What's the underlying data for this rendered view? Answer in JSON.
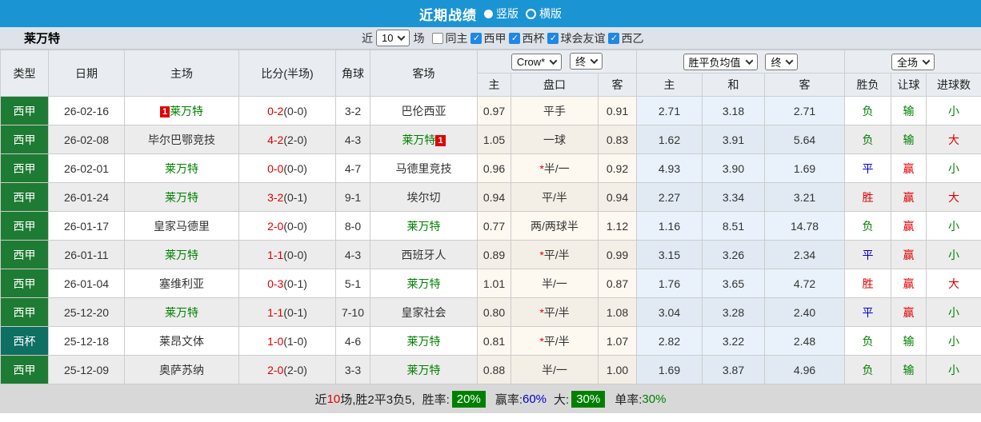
{
  "colors": {
    "title_bar_blue": "#1b94d3",
    "league_green": "#1e7b33",
    "cup_teal": "#0e6f63",
    "levante_green": "#008000",
    "loss_red": "#e00000",
    "draw_blue": "#0000cc",
    "checkbox_blue": "#1e88e5",
    "badge_green": "#008000"
  },
  "title_bar": {
    "title": "近期战绩",
    "options": [
      {
        "label": "竖版",
        "checked": true
      },
      {
        "label": "横版",
        "checked": false
      }
    ]
  },
  "filter_bar": {
    "team": "莱万特",
    "near_label": "近",
    "count_value": "10",
    "games_label": "场",
    "same_home_label": "同主",
    "same_home_checked": false,
    "leagues": [
      "西甲",
      "西杯",
      "球会友谊",
      "西乙"
    ]
  },
  "header": {
    "col_type": "类型",
    "col_date": "日期",
    "col_home": "主场",
    "col_score": "比分(半场)",
    "col_corner": "角球",
    "col_away": "客场",
    "dd_company": "Crow*",
    "dd_final1": "终",
    "dd_avg": "胜平负均值",
    "dd_final2": "终",
    "dd_scope": "全场",
    "sub": [
      "主",
      "盘口",
      "客",
      "主",
      "和",
      "客",
      "胜负",
      "让球",
      "进球数"
    ]
  },
  "rows": [
    {
      "type": "西甲",
      "type_color": "green",
      "date": "26-02-16",
      "home": {
        "name": "莱万特",
        "levante": true,
        "card": "1",
        "card_pos": "before"
      },
      "score": "0-2",
      "half": "(0-0)",
      "corner": "3-2",
      "away": {
        "name": "巴伦西亚",
        "levante": false,
        "card": null
      },
      "odds_home": "0.97",
      "handicap": "平手",
      "handicap_star": false,
      "odds_away": "0.91",
      "avg_home": "2.71",
      "avg_draw": "3.18",
      "avg_away": "2.71",
      "result": {
        "text": "负",
        "color": "green"
      },
      "cover": {
        "text": "输",
        "color": "green"
      },
      "goals": {
        "text": "小",
        "color": "green"
      }
    },
    {
      "type": "西甲",
      "type_color": "green",
      "date": "26-02-08",
      "home": {
        "name": "毕尔巴鄂竞技",
        "levante": false,
        "card": null
      },
      "score": "4-2",
      "half": "(2-0)",
      "corner": "4-3",
      "away": {
        "name": "莱万特",
        "levante": true,
        "card": "1",
        "card_pos": "after"
      },
      "odds_home": "1.05",
      "handicap": "一球",
      "handicap_star": false,
      "odds_away": "0.83",
      "avg_home": "1.62",
      "avg_draw": "3.91",
      "avg_away": "5.64",
      "result": {
        "text": "负",
        "color": "green"
      },
      "cover": {
        "text": "输",
        "color": "green"
      },
      "goals": {
        "text": "大",
        "color": "red"
      }
    },
    {
      "type": "西甲",
      "type_color": "green",
      "date": "26-02-01",
      "home": {
        "name": "莱万特",
        "levante": true,
        "card": null
      },
      "score": "0-0",
      "half": "(0-0)",
      "corner": "4-7",
      "away": {
        "name": "马德里竞技",
        "levante": false,
        "card": null
      },
      "odds_home": "0.96",
      "handicap": "半/一",
      "handicap_star": true,
      "odds_away": "0.92",
      "avg_home": "4.93",
      "avg_draw": "3.90",
      "avg_away": "1.69",
      "result": {
        "text": "平",
        "color": "blue"
      },
      "cover": {
        "text": "赢",
        "color": "red"
      },
      "goals": {
        "text": "小",
        "color": "green"
      }
    },
    {
      "type": "西甲",
      "type_color": "green",
      "date": "26-01-24",
      "home": {
        "name": "莱万特",
        "levante": true,
        "card": null
      },
      "score": "3-2",
      "half": "(0-1)",
      "corner": "9-1",
      "away": {
        "name": "埃尔切",
        "levante": false,
        "card": null
      },
      "odds_home": "0.94",
      "handicap": "平/半",
      "handicap_star": false,
      "odds_away": "0.94",
      "avg_home": "2.27",
      "avg_draw": "3.34",
      "avg_away": "3.21",
      "result": {
        "text": "胜",
        "color": "red"
      },
      "cover": {
        "text": "赢",
        "color": "red"
      },
      "goals": {
        "text": "大",
        "color": "red"
      }
    },
    {
      "type": "西甲",
      "type_color": "green",
      "date": "26-01-17",
      "home": {
        "name": "皇家马德里",
        "levante": false,
        "card": null
      },
      "score": "2-0",
      "half": "(0-0)",
      "corner": "8-0",
      "away": {
        "name": "莱万特",
        "levante": true,
        "card": null
      },
      "odds_home": "0.77",
      "handicap": "两/两球半",
      "handicap_star": false,
      "odds_away": "1.12",
      "avg_home": "1.16",
      "avg_draw": "8.51",
      "avg_away": "14.78",
      "result": {
        "text": "负",
        "color": "green"
      },
      "cover": {
        "text": "赢",
        "color": "red"
      },
      "goals": {
        "text": "小",
        "color": "green"
      }
    },
    {
      "type": "西甲",
      "type_color": "green",
      "date": "26-01-11",
      "home": {
        "name": "莱万特",
        "levante": true,
        "card": null
      },
      "score": "1-1",
      "half": "(0-0)",
      "corner": "4-3",
      "away": {
        "name": "西班牙人",
        "levante": false,
        "card": null
      },
      "odds_home": "0.89",
      "handicap": "平/半",
      "handicap_star": true,
      "odds_away": "0.99",
      "avg_home": "3.15",
      "avg_draw": "3.26",
      "avg_away": "2.34",
      "result": {
        "text": "平",
        "color": "blue"
      },
      "cover": {
        "text": "赢",
        "color": "red"
      },
      "goals": {
        "text": "小",
        "color": "green"
      }
    },
    {
      "type": "西甲",
      "type_color": "green",
      "date": "26-01-04",
      "home": {
        "name": "塞维利亚",
        "levante": false,
        "card": null
      },
      "score": "0-3",
      "half": "(0-1)",
      "corner": "5-1",
      "away": {
        "name": "莱万特",
        "levante": true,
        "card": null
      },
      "odds_home": "1.01",
      "handicap": "半/一",
      "handicap_star": false,
      "odds_away": "0.87",
      "avg_home": "1.76",
      "avg_draw": "3.65",
      "avg_away": "4.72",
      "result": {
        "text": "胜",
        "color": "red"
      },
      "cover": {
        "text": "赢",
        "color": "red"
      },
      "goals": {
        "text": "大",
        "color": "red"
      }
    },
    {
      "type": "西甲",
      "type_color": "green",
      "date": "25-12-20",
      "home": {
        "name": "莱万特",
        "levante": true,
        "card": null
      },
      "score": "1-1",
      "half": "(0-1)",
      "corner": "7-10",
      "away": {
        "name": "皇家社会",
        "levante": false,
        "card": null
      },
      "odds_home": "0.80",
      "handicap": "平/半",
      "handicap_star": true,
      "odds_away": "1.08",
      "avg_home": "3.04",
      "avg_draw": "3.28",
      "avg_away": "2.40",
      "result": {
        "text": "平",
        "color": "blue"
      },
      "cover": {
        "text": "赢",
        "color": "red"
      },
      "goals": {
        "text": "小",
        "color": "green"
      }
    },
    {
      "type": "西杯",
      "type_color": "teal",
      "date": "25-12-18",
      "home": {
        "name": "莱昂文体",
        "levante": false,
        "card": null
      },
      "score": "1-0",
      "half": "(1-0)",
      "corner": "4-6",
      "away": {
        "name": "莱万特",
        "levante": true,
        "card": null
      },
      "odds_home": "0.81",
      "handicap": "平/半",
      "handicap_star": true,
      "odds_away": "1.07",
      "avg_home": "2.82",
      "avg_draw": "3.22",
      "avg_away": "2.48",
      "result": {
        "text": "负",
        "color": "green"
      },
      "cover": {
        "text": "输",
        "color": "green"
      },
      "goals": {
        "text": "小",
        "color": "green"
      }
    },
    {
      "type": "西甲",
      "type_color": "green",
      "date": "25-12-09",
      "home": {
        "name": "奥萨苏纳",
        "levante": false,
        "card": null
      },
      "score": "2-0",
      "half": "(2-0)",
      "corner": "3-3",
      "away": {
        "name": "莱万特",
        "levante": true,
        "card": null
      },
      "odds_home": "0.88",
      "handicap": "半/一",
      "handicap_star": false,
      "odds_away": "1.00",
      "avg_home": "1.69",
      "avg_draw": "3.87",
      "avg_away": "4.96",
      "result": {
        "text": "负",
        "color": "green"
      },
      "cover": {
        "text": "输",
        "color": "green"
      },
      "goals": {
        "text": "小",
        "color": "green"
      }
    }
  ],
  "footer": {
    "prefix": "近",
    "count": "10",
    "summary": "场,胜2平3负5,",
    "win_rate_label": "胜率:",
    "win_rate": "20%",
    "cover_rate_label": "赢率:",
    "cover_rate": "60%",
    "big_label": "大:",
    "big_rate": "30%",
    "single_label": "单率:",
    "single_rate": "30%"
  }
}
